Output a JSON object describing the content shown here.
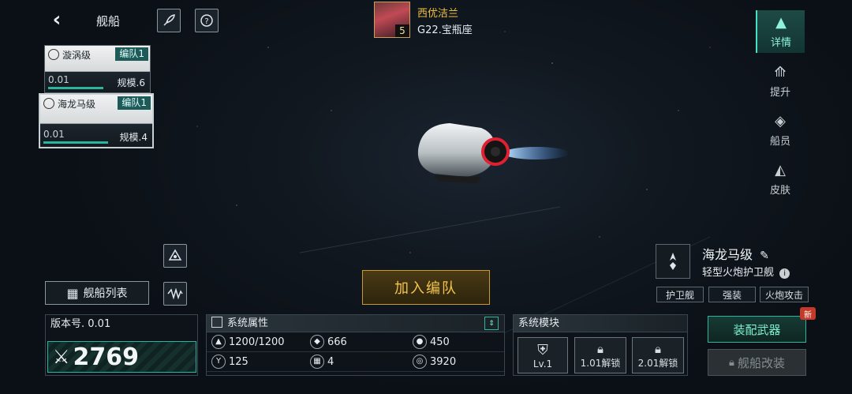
{
  "header": {
    "title": "舰船",
    "back_icon": "chevron-left-icon",
    "rocket_icon": "rocket-icon",
    "help_icon": "help-icon"
  },
  "commander": {
    "name": "西优洁兰",
    "level": "5",
    "location": "G22.宝瓶座"
  },
  "ship_cards": [
    {
      "name": "漩涡级",
      "fleet": "编队1",
      "value": "0.01",
      "scale": "规模.6"
    },
    {
      "name": "海龙马级",
      "fleet": "编队1",
      "value": "0.01",
      "scale": "规模.4"
    }
  ],
  "right_tabs": [
    {
      "label": "详情",
      "active": true
    },
    {
      "label": "提升"
    },
    {
      "label": "船员"
    },
    {
      "label": "皮肤"
    }
  ],
  "ship_info": {
    "name": "海龙马级",
    "type": "轻型火炮护卫舰",
    "tags": [
      "护卫舰",
      "强装",
      "火炮攻击"
    ]
  },
  "buttons": {
    "join": "加入编队",
    "ship_list": "舰船列表",
    "equip": "装配武器",
    "refit": "舰船改装",
    "new_badge": "新"
  },
  "version": {
    "label": "版本号. 0.01",
    "power": "2769"
  },
  "attributes": {
    "title": "系统属性",
    "stats": [
      {
        "icon": "hull-icon",
        "value": "1200/1200"
      },
      {
        "icon": "armor-icon",
        "value": "666"
      },
      {
        "icon": "shield-icon",
        "value": "450"
      },
      {
        "icon": "speed-icon",
        "value": "125"
      },
      {
        "icon": "grid-icon",
        "value": "4"
      },
      {
        "icon": "target-icon",
        "value": "3920"
      }
    ]
  },
  "modules": {
    "title": "系统模块",
    "items": [
      {
        "label": "Lv.1",
        "icon": "shield-icon"
      },
      {
        "label": "1.01解锁",
        "icon": "lock-icon"
      },
      {
        "label": "2.01解锁",
        "icon": "lock-icon"
      }
    ]
  },
  "colors": {
    "accent": "#2bb59f",
    "gold": "#f4c54c",
    "commander_name": "#f0c040"
  }
}
